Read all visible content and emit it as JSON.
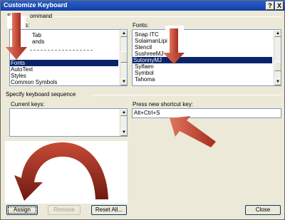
{
  "window": {
    "title": "Customize Keyboard",
    "help_button": "?",
    "close_button": "X"
  },
  "command_group": {
    "label_partial_left": "S",
    "label_partial_right": "ommand"
  },
  "left_list": {
    "label_partial": "s:",
    "items": [
      "Tab",
      "ands",
      "",
      "",
      "Fonts",
      "AutoText",
      "Styles",
      "Common Symbols"
    ],
    "selected_index": 4
  },
  "fonts_list": {
    "label": "Fonts:",
    "items": [
      "Snap ITC",
      "SolaimanLipi",
      "Stencil",
      "SushreeMJ",
      "SutonnyMJ",
      "Sylfaen",
      "Symbol",
      "Tahoma"
    ],
    "selected_index": 4
  },
  "keyboard_group": {
    "label": "Specify keyboard sequence"
  },
  "current_keys": {
    "label": "Current keys:"
  },
  "new_shortcut": {
    "label": "Press new shortcut key:",
    "value": "Alt+Ctrl+S"
  },
  "buttons": {
    "assign": "Assign",
    "remove": "Remove",
    "reset_all": "Reset All...",
    "close": "Close"
  },
  "annotation": {
    "arrow_color": "#b5382a"
  }
}
